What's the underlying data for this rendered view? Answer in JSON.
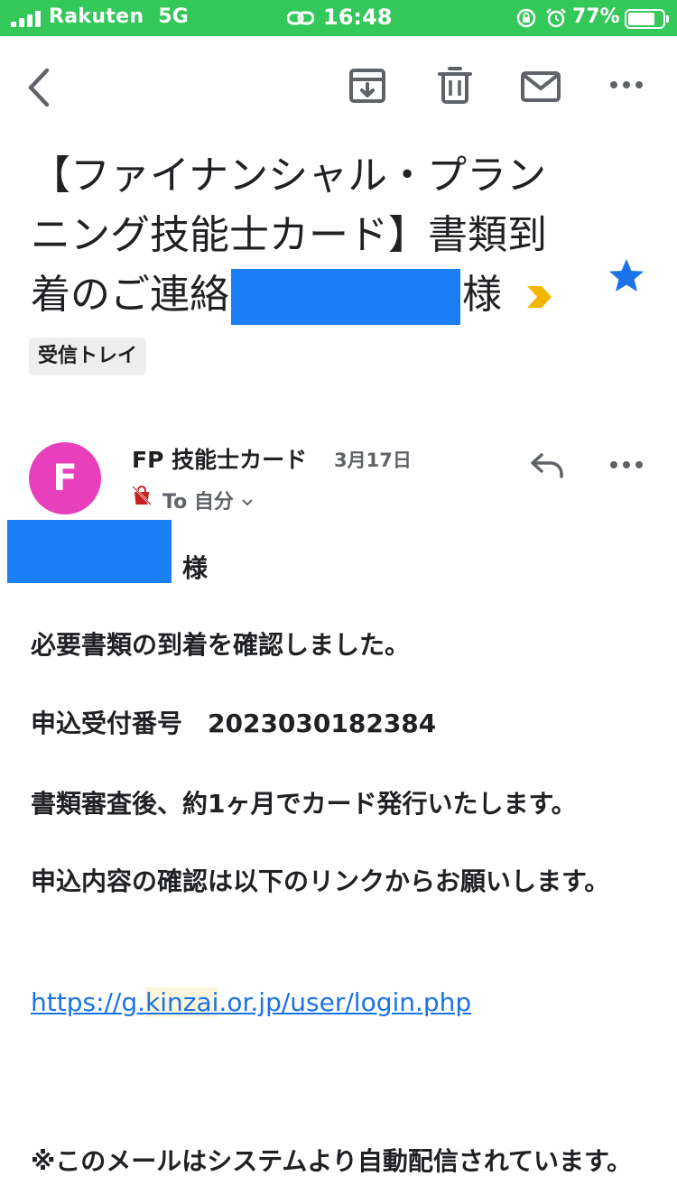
{
  "status_bar": {
    "carrier": "Rakuten",
    "network": "5G",
    "time": "16:48",
    "battery_percent": "77%"
  },
  "toolbar": {
    "icons": [
      "back-icon",
      "archive-icon",
      "trash-icon",
      "mail-icon",
      "more-icon"
    ]
  },
  "email": {
    "subject_part1": "【ファイナンシャル・プランニング技能士カード】書類到着のご連絡",
    "subject_part2": "様",
    "starred": true,
    "label": "受信トレイ",
    "sender_initial": "F",
    "sender_name": "FP 技能士カード",
    "date": "3月17日",
    "recipient_line": "To 自分",
    "greeting_suffix": "様",
    "body": {
      "line1": "必要書類の到着を確認しました。",
      "line2": "申込受付番号　2023030182384",
      "line3": "書類審査後、約1ヶ月でカード発行いたします。",
      "line4": "申込内容の確認は以下のリンクからお願いします。",
      "link_prefix": "https://g.",
      "link_highlight": "kinzai",
      "link_suffix": ".or.jp/user/login.php",
      "line6": "※このメールはシステムより自動配信されています。"
    }
  },
  "colors": {
    "status_bar": "#34c759",
    "star": "#1a73e8",
    "importance": "#f4b400",
    "avatar": "#e83fbd",
    "redaction": "#1a7ef5",
    "link": "#1a73e8"
  }
}
